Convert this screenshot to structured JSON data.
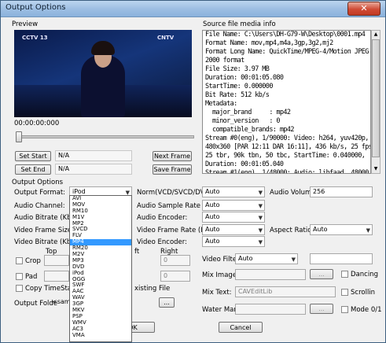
{
  "window": {
    "title": "Output Options",
    "close_glyph": "✕"
  },
  "preview": {
    "label": "Preview",
    "time": "00:00:00:000",
    "set_start": "Set Start",
    "set_end": "Set End",
    "start_value": "N/A",
    "end_value": "N/A",
    "next_frame": "Next Frame",
    "save_frame": "Save Frame",
    "channel_logo_left": "CCTV 13",
    "channel_logo_right": "CNTV"
  },
  "source_info": {
    "label": "Source file media info",
    "lines": [
      "File Name: C:\\Users\\DH-G79-W\\Desktop\\0001.mp4",
      "Format Name: mov,mp4,m4a,3gp,3g2,mj2",
      "Format Long Name: QuickTime/MPEG-4/Motion JPEG",
      "2000 format",
      "File Size: 3.97 MB",
      "Duration: 00:01:05.080",
      "StartTime: 0.000000",
      "Bit Rate: 512 kb/s",
      "Metadata:",
      "  major_brand     : mp42",
      "  minor_version   : 0",
      "  compatible_brands: mp42",
      "Stream #0(eng), 1/90000: Video: h264, yuv420p,",
      "480x360 [PAR 12:11 DAR 16:11], 436 kb/s, 25 fps,",
      "25 tbr, 90k tbn, 50 tbc, StartTime: 0.040000,",
      "Duration: 00:01:05.040",
      "Stream #1(eng), 1/48000: Audio: libfaad, 48000 Hz,"
    ]
  },
  "output_options": {
    "label": "Output Options",
    "output_format_label": "Output Format:",
    "output_format_value": "iPod",
    "audio_channel_label": "Audio Channel:",
    "audio_bitrate_label": "Audio Bitrate (Kbp",
    "video_frame_size_label": "Video Frame Size:",
    "video_bitrate_label": "Video Bitrate (Kbp",
    "norm_label": "Norm(VCD/SVCD/DVD):",
    "norm_value": "Auto",
    "audio_volume_label": "Audio Volume:",
    "audio_volume_value": "256",
    "audio_sample_rate_label": "Audio Sample Rate (Hz",
    "audio_sample_rate_value": "Auto",
    "audio_encoder_label": "Audio Encoder:",
    "audio_encoder_value": "Auto",
    "video_frame_rate_label": "Video Frame Rate (FPS",
    "video_frame_rate_value": "Auto",
    "aspect_ratio_label": "Aspect Ratio:",
    "aspect_ratio_value": "Auto",
    "video_encoder_label": "Video Encoder:",
    "video_encoder_value": "Auto",
    "top_label": "Top",
    "left_label": "ft",
    "right_label": "Right",
    "crop_label": "Crop",
    "pad_label": "Pad",
    "crop_right_value": "0",
    "pad_right_value": "0",
    "copy_timestamp_label": "Copy TimeStamp",
    "existing_file_label": "xisting File",
    "output_folder_label": "Output Folde",
    "output_folder_value": "<same",
    "browse_label": "...",
    "video_filter_label": "Video Filte",
    "video_filter_value": "Auto",
    "mix_image_label": "Mix Image:",
    "mix_image_browse": "...",
    "dancing_label": "Dancing",
    "mix_text_label": "Mix Text:",
    "mix_text_value": "CAVEditLib",
    "scrolling_label": "Scrollin",
    "water_mark_label": "Water Mark:",
    "water_mark_browse": "...",
    "mode_label": "Mode 0/1"
  },
  "format_list": [
    "AVI",
    "MOV",
    "RM10",
    "M1V",
    "MP2",
    "SVCD",
    "FLV",
    "MP4",
    "RM20",
    "M2V",
    "MP3",
    "DVD",
    "iPod",
    "OGG",
    "SWF",
    "AAC",
    "WAV",
    "3GP",
    "MKV",
    "PSP",
    "WMV",
    "AC3",
    "VMA"
  ],
  "format_selected": "MP4",
  "buttons": {
    "ok": "OK",
    "cancel": "Cancel"
  },
  "colors": {
    "selection": "#3399ff",
    "title_bar": "#9ebfe3"
  }
}
